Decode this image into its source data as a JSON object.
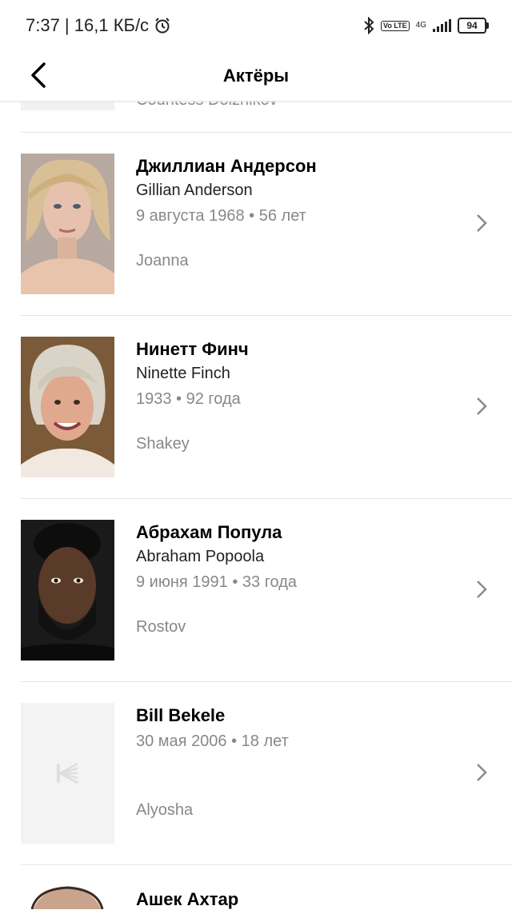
{
  "status_bar": {
    "time_speed": "7:37 | 16,1 КБ/с",
    "volte": "Vo LTE",
    "network": "4G",
    "battery": "94"
  },
  "header": {
    "title": "Актёры"
  },
  "partial_top": {
    "role": "Countess Dolzhikov"
  },
  "actors": [
    {
      "name": "Джиллиан Андерсон",
      "original_name": "Gillian Anderson",
      "meta": "9 августа 1968 • 56 лет",
      "role": "Joanna"
    },
    {
      "name": "Нинетт Финч",
      "original_name": "Ninette Finch",
      "meta": "1933 • 92 года",
      "role": "Shakey"
    },
    {
      "name": "Абрахам Попула",
      "original_name": "Abraham Popoola",
      "meta": "9 июня 1991 • 33 года",
      "role": "Rostov"
    },
    {
      "name": "Bill Bekele",
      "original_name": "",
      "meta": "30 мая 2006 • 18 лет",
      "role": "Alyosha"
    }
  ],
  "partial_bottom": {
    "name": "Ашек Ахтар"
  }
}
